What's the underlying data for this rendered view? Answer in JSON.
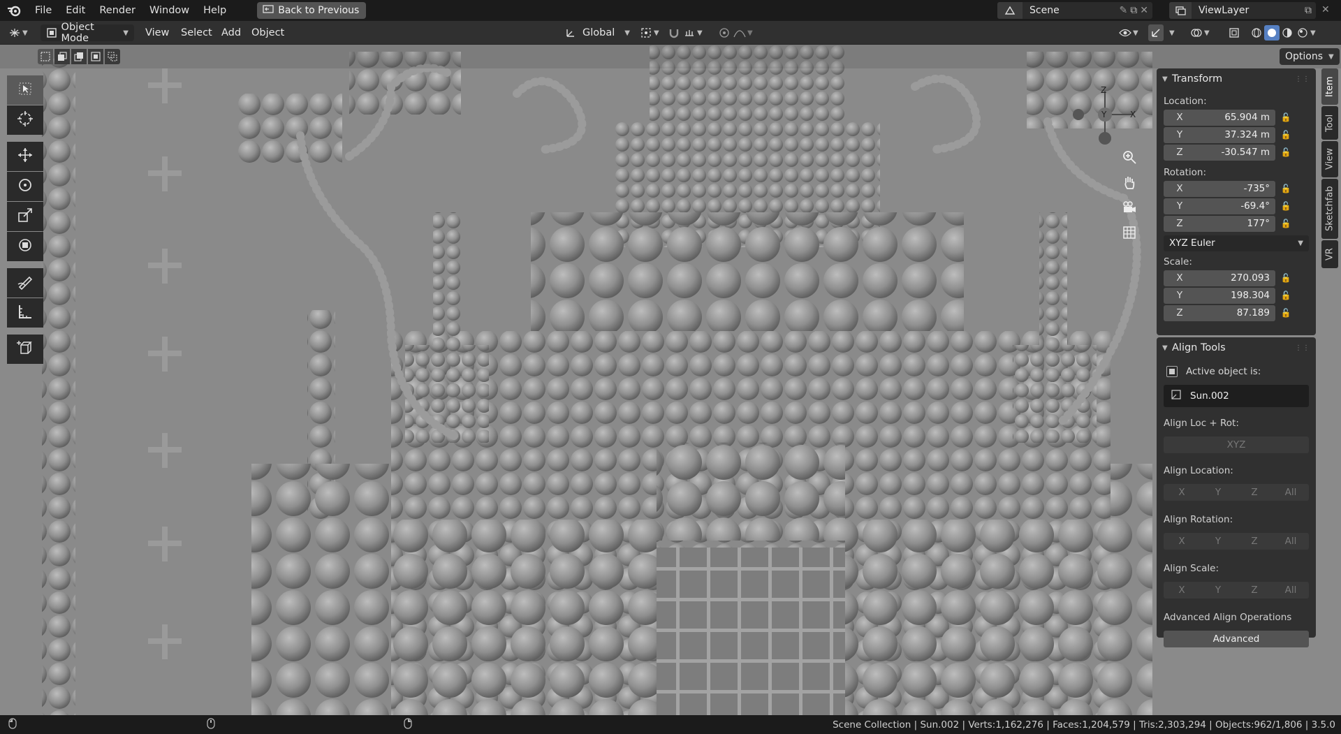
{
  "menu": [
    "File",
    "Edit",
    "Render",
    "Window",
    "Help"
  ],
  "back_button": "Back to Previous",
  "scene": {
    "label": "Scene"
  },
  "view_layer": {
    "label": "ViewLayer"
  },
  "header": {
    "mode": "Object Mode",
    "menus": [
      "View",
      "Select",
      "Add",
      "Object"
    ],
    "transform_orientation": "Global",
    "options": "Options"
  },
  "gizmo": {
    "z": "Z",
    "y": "Y",
    "x": "X"
  },
  "transform": {
    "title": "Transform",
    "location_label": "Location:",
    "location": [
      {
        "axis": "X",
        "value": "65.904 m"
      },
      {
        "axis": "Y",
        "value": "37.324 m"
      },
      {
        "axis": "Z",
        "value": "-30.547 m"
      }
    ],
    "rotation_label": "Rotation:",
    "rotation": [
      {
        "axis": "X",
        "value": "-735°"
      },
      {
        "axis": "Y",
        "value": "-69.4°"
      },
      {
        "axis": "Z",
        "value": "177°"
      }
    ],
    "rotation_mode": "XYZ Euler",
    "scale_label": "Scale:",
    "scale": [
      {
        "axis": "X",
        "value": "270.093"
      },
      {
        "axis": "Y",
        "value": "198.304"
      },
      {
        "axis": "Z",
        "value": "87.189"
      }
    ]
  },
  "align": {
    "title": "Align Tools",
    "active_label": "Active object is:",
    "active_object": "Sun.002",
    "loc_rot_label": "Align Loc + Rot:",
    "loc_rot_btn": "XYZ",
    "location_label": "Align Location:",
    "rotation_label": "Align Rotation:",
    "scale_label": "Align Scale:",
    "axis_buttons": [
      "X",
      "Y",
      "Z",
      "All"
    ],
    "advanced_label": "Advanced Align Operations",
    "advanced_btn": "Advanced"
  },
  "sidetabs": [
    "Item",
    "Tool",
    "View",
    "Sketchfab",
    "VR"
  ],
  "status": "Scene Collection | Sun.002 | Verts:1,162,276 | Faces:1,204,579 | Tris:2,303,294 | Objects:962/1,806 | 3.5.0"
}
